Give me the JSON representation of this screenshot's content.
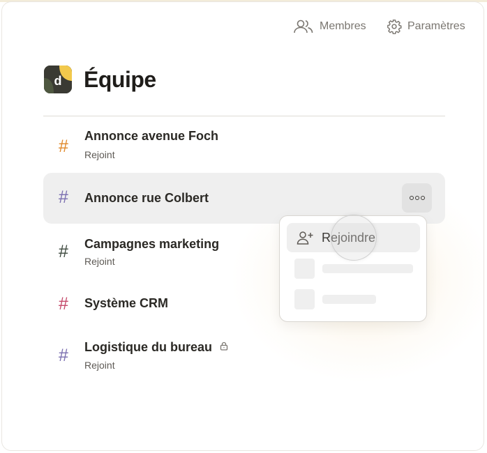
{
  "header": {
    "members_label": "Membres",
    "settings_label": "Paramètres",
    "title": "Équipe",
    "logo_letter": "d"
  },
  "channels": [
    {
      "symbol": "#",
      "name": "Annonce avenue Foch",
      "status": "Rejoint",
      "color": "#e0892b"
    },
    {
      "symbol": "#",
      "name": "Annonce rue Colbert",
      "status": "",
      "color": "#7b6fb0"
    },
    {
      "symbol": "#",
      "name": "Campagnes marketing",
      "status": "Rejoint",
      "color": "#3e4a3f"
    },
    {
      "symbol": "#",
      "name": "Système CRM",
      "status": "",
      "color": "#c54b6b"
    },
    {
      "symbol": "#",
      "name": "Logistique du bureau",
      "status": "Rejoint",
      "color": "#7b6fb0"
    }
  ],
  "context_menu": {
    "join_label": "Rejoindre"
  },
  "colors": {
    "logo_bg": "#3a3a33",
    "logo_accent": "#f2c94c",
    "hover_row": "#efefef"
  }
}
